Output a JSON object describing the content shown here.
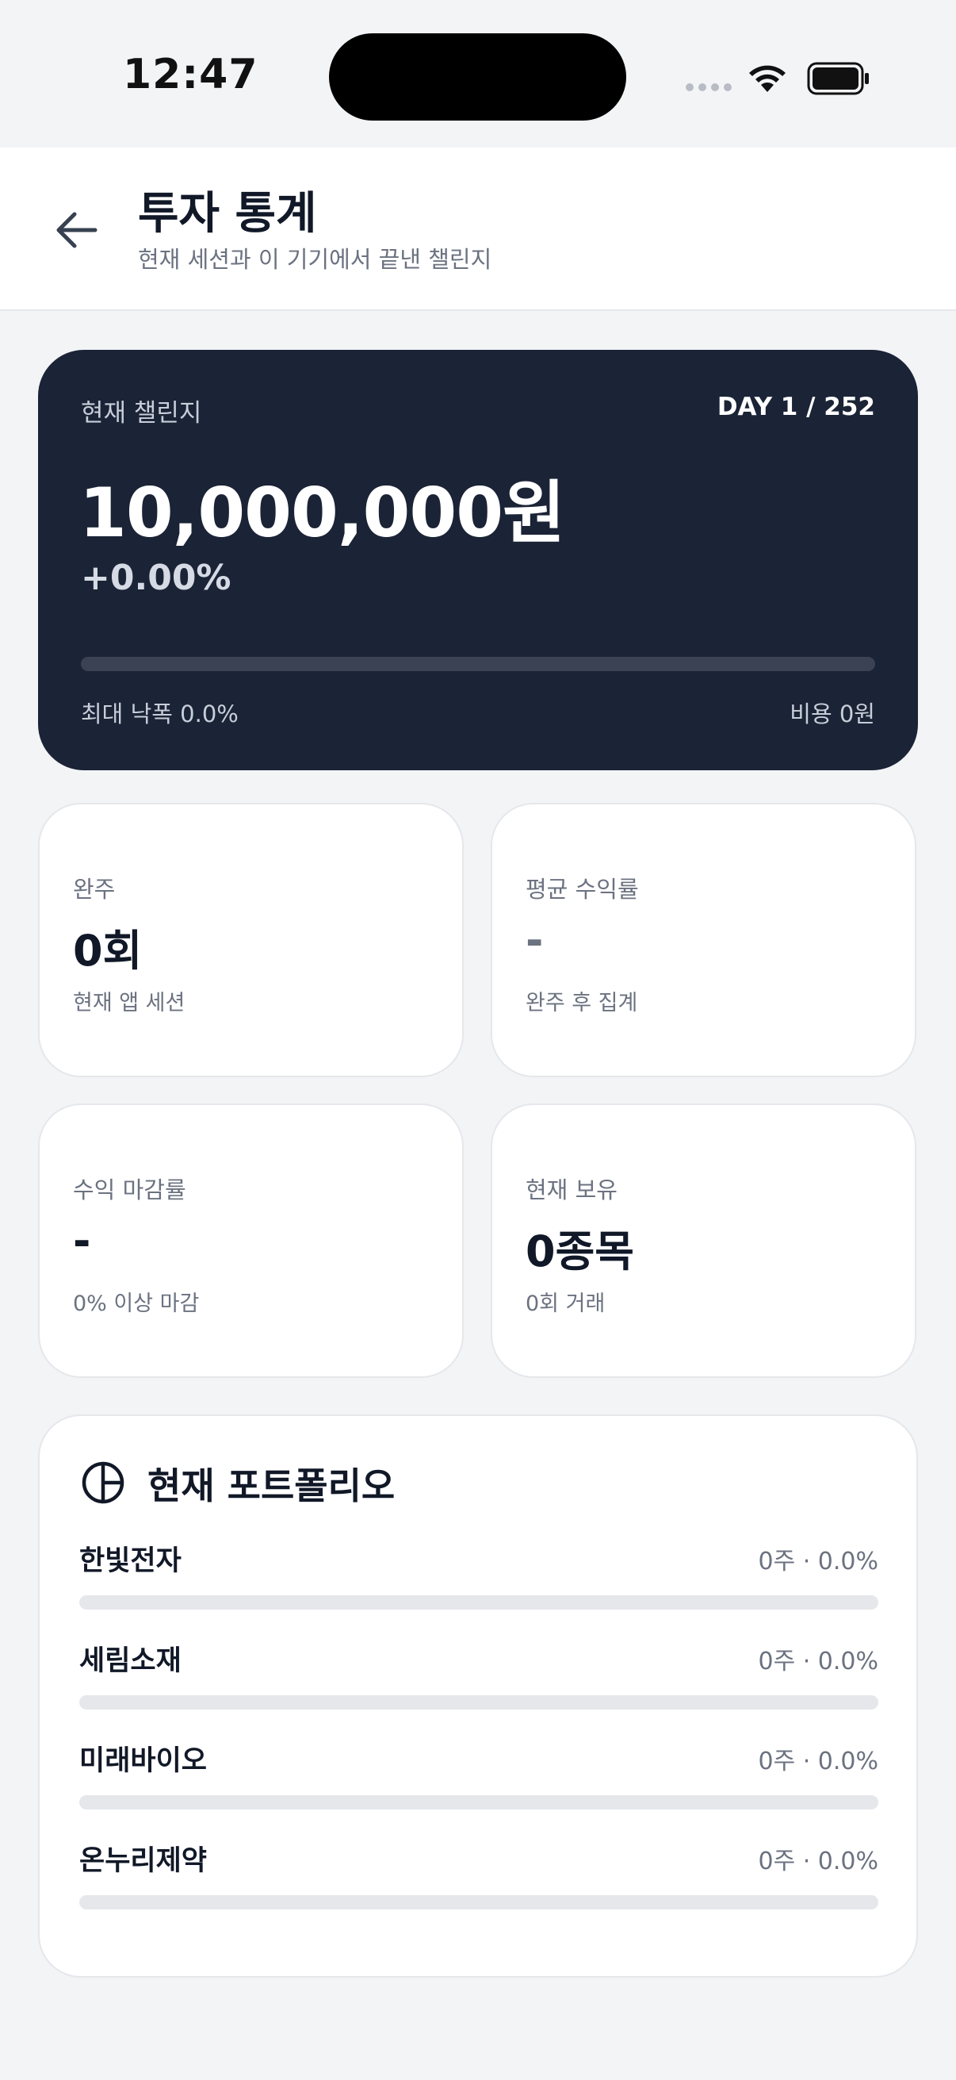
{
  "status_bar": {
    "time": "12:47"
  },
  "header": {
    "title": "투자 통계",
    "subtitle": "현재 세션과 이 기기에서 끝낸 챌린지"
  },
  "hero": {
    "label": "현재 챌린지",
    "day": "DAY 1 / 252",
    "amount": "10,000,000원",
    "rate": "+0.00%",
    "progress_fraction": 0,
    "max_drawdown": "최대 낙폭 0.0%",
    "cost": "비용 0원"
  },
  "stats": [
    {
      "label": "완주",
      "value": "0회",
      "sub": "현재 앱 세션"
    },
    {
      "label": "평균 수익률",
      "value": "-",
      "sub": "완주 후 집계"
    },
    {
      "label": "수익 마감률",
      "value": "-",
      "sub": "0% 이상 마감"
    },
    {
      "label": "현재 보유",
      "value": "0종목",
      "sub": "0회 거래"
    }
  ],
  "portfolio": {
    "title": "현재 포트폴리오",
    "items": [
      {
        "name": "한빛전자",
        "meta": "0주 · 0.0%",
        "fraction": 0
      },
      {
        "name": "세림소재",
        "meta": "0주 · 0.0%",
        "fraction": 0
      },
      {
        "name": "미래바이오",
        "meta": "0주 · 0.0%",
        "fraction": 0
      },
      {
        "name": "온누리제약",
        "meta": "0주 · 0.0%",
        "fraction": 0
      }
    ]
  }
}
